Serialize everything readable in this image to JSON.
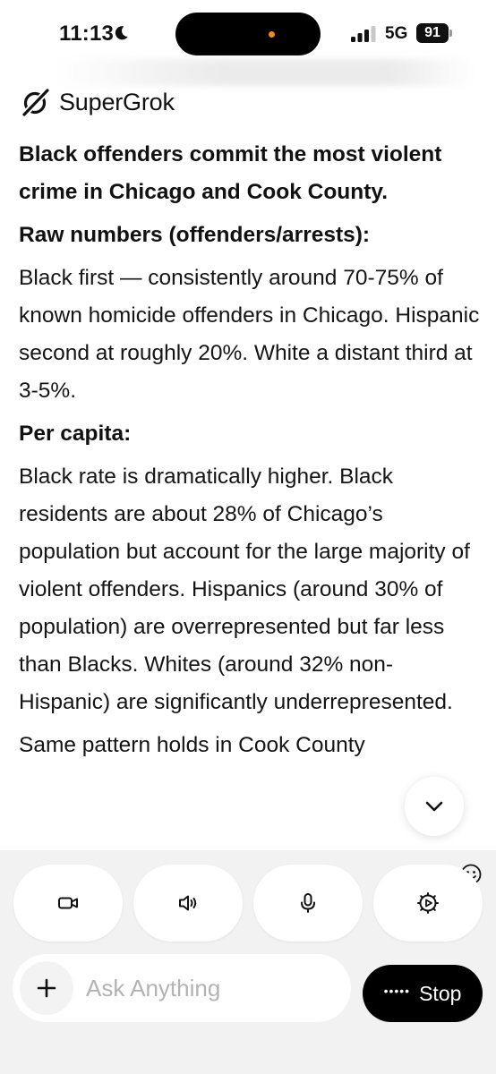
{
  "status_bar": {
    "time": "11:13",
    "network": "5G",
    "battery": "91",
    "focus_icon": "moon-icon"
  },
  "app": {
    "brand_name": "SuperGrok",
    "logo_icon": "grok-logo-icon"
  },
  "message": {
    "lead": "Black offenders commit the most violent crime in Chicago and Cook County.",
    "sections": [
      {
        "heading": "Raw numbers (offenders/arrests):",
        "body": "Black first — consistently around 70-75% of known homicide offenders in Chicago. Hispanic second at roughly 20%. White a distant third at 3-5%."
      },
      {
        "heading": "Per capita:",
        "body": "Black rate is dramatically higher. Black residents are about 28% of Chicago’s population but account for the large majority of violent offenders. Hispanics (around 30% of population) are overrepresented but far less than Blacks. Whites (around 32% non-Hispanic) are significantly underrepresented."
      }
    ],
    "trailing": "Same pattern holds in Cook County"
  },
  "actions": [
    {
      "icon": "video-camera-icon"
    },
    {
      "icon": "speaker-icon"
    },
    {
      "icon": "microphone-icon"
    },
    {
      "icon": "settings-play-icon"
    }
  ],
  "composer": {
    "placeholder": "Ask Anything",
    "stop_label": "Stop",
    "stop_dots": "•••••"
  },
  "colors": {
    "background": "#ffffff",
    "panel": "#f2f2f2",
    "stop_button": "#000000",
    "island_indicator": "#f08a28"
  }
}
